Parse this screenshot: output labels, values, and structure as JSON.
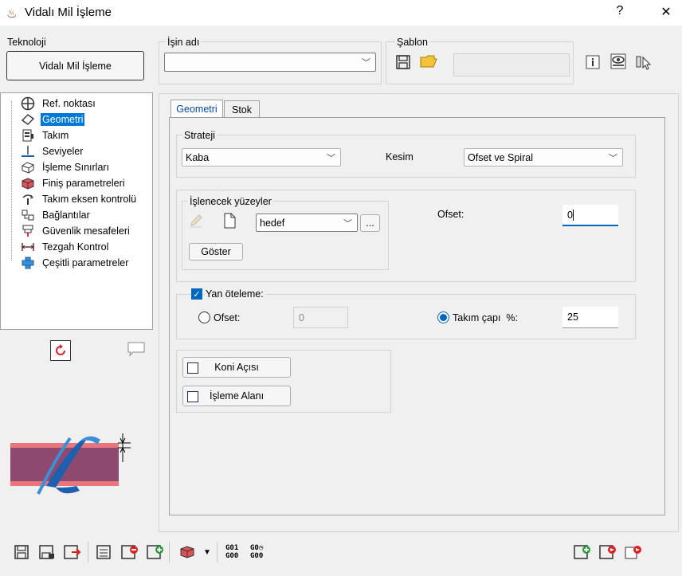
{
  "window": {
    "title": "Vidalı Mil İşleme",
    "help": "?",
    "close": "✕"
  },
  "teknoloji": {
    "label": "Teknoloji",
    "button": "Vidalı Mil İşleme"
  },
  "isin_adi": {
    "label": "İşin adı",
    "value": ""
  },
  "sablon": {
    "label": "Şablon",
    "value": ""
  },
  "tree": {
    "items": [
      {
        "label": "Ref. noktası",
        "icon": "reference-point-icon"
      },
      {
        "label": "Geometri",
        "icon": "geometry-icon"
      },
      {
        "label": "Takım",
        "icon": "tool-icon"
      },
      {
        "label": "Seviyeler",
        "icon": "levels-icon"
      },
      {
        "label": "İşleme Sınırları",
        "icon": "machining-limits-icon"
      },
      {
        "label": "Finiş parametreleri",
        "icon": "finish-parameters-icon"
      },
      {
        "label": "Takım eksen kontrolü",
        "icon": "tool-axis-icon"
      },
      {
        "label": "Bağlantılar",
        "icon": "links-icon"
      },
      {
        "label": "Güvenlik mesafeleri",
        "icon": "safety-distance-icon"
      },
      {
        "label": "Tezgah Kontrol",
        "icon": "machine-control-icon"
      },
      {
        "label": "Çeşitli parametreler",
        "icon": "misc-parameters-icon"
      }
    ],
    "selected_index": 1
  },
  "tabs": [
    {
      "label": "Geometri"
    },
    {
      "label": "Stok"
    }
  ],
  "strateji": {
    "label": "Strateji",
    "value": "Kaba",
    "kesim_label": "Kesim",
    "kesim_value": "Ofset ve Spiral"
  },
  "islenecek": {
    "label": "İşlenecek yüzeyler",
    "combo_value": "hedef",
    "browse": "...",
    "goster": "Göster",
    "ofset_label": "Ofset:",
    "ofset_value": "0"
  },
  "yan_oteleme": {
    "label": "Yan öteleme:",
    "checked": true,
    "ofset_label": "Ofset:",
    "ofset_value": "0",
    "takim_label": "Takım çapı  %:",
    "takim_value": "25"
  },
  "extras": {
    "koni": "Koni Açısı",
    "isleme_alani": "İşleme Alanı"
  },
  "toolbar_bottom": {
    "g01": "G01",
    "g00": "G00",
    "g01b": "G00"
  }
}
